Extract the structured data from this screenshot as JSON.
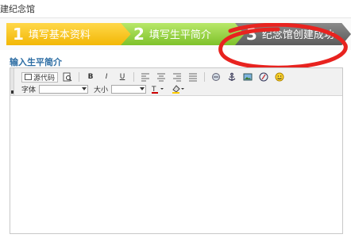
{
  "header": {
    "title": "建纪念馆"
  },
  "steps": [
    {
      "num": "1",
      "label": "填写基本资料",
      "state": "done",
      "color": "#f2b705"
    },
    {
      "num": "2",
      "label": "填写生平简介",
      "state": "current",
      "color": "#7ec12a"
    },
    {
      "num": "3",
      "label": "纪念馆创建成功",
      "state": "pending",
      "color": "#5a5a5a"
    }
  ],
  "section": {
    "title": "输入生平简介"
  },
  "toolbar": {
    "source_label": "源代码",
    "bold": "B",
    "italic": "I",
    "underline": "U",
    "font_label": "字体",
    "font_value": "",
    "size_label": "大小",
    "size_value": "",
    "icons": [
      "source-code-icon",
      "preview-icon",
      "bold-icon",
      "italic-icon",
      "underline-icon",
      "align-left-icon",
      "align-center-icon",
      "align-right-icon",
      "justify-icon",
      "link-icon",
      "anchor-icon",
      "image-icon",
      "flash-icon",
      "emoticon-icon",
      "text-color-icon",
      "background-color-icon"
    ]
  },
  "annotation": {
    "color": "#e8231f"
  }
}
